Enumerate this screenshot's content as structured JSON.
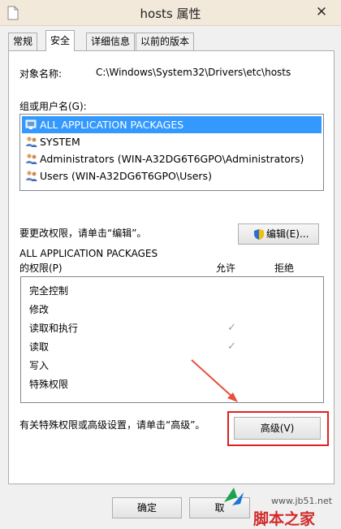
{
  "window": {
    "title": "hosts 属性",
    "close_glyph": "✕"
  },
  "tabs": [
    {
      "label": "常规"
    },
    {
      "label": "安全"
    },
    {
      "label": "详细信息"
    },
    {
      "label": "以前的版本"
    }
  ],
  "security": {
    "object_name_label": "对象名称:",
    "object_name_value": "C:\\Windows\\System32\\Drivers\\etc\\hosts",
    "users_label": "组或用户名(G):",
    "users": [
      {
        "name": "ALL APPLICATION PACKAGES",
        "selected": true
      },
      {
        "name": "SYSTEM"
      },
      {
        "name": "Administrators (WIN-A32DG6T6GPO\\Administrators)"
      },
      {
        "name": "Users (WIN-A32DG6T6GPO\\Users)"
      }
    ],
    "change_hint": "要更改权限，请单击“编辑”。",
    "edit_button": "编辑(E)...",
    "perm_for_line1": "ALL APPLICATION PACKAGES",
    "perm_for_line2": "的权限(P)",
    "allow_header": "允许",
    "deny_header": "拒绝",
    "permissions": [
      {
        "name": "完全控制",
        "allow": false
      },
      {
        "name": "修改",
        "allow": false
      },
      {
        "name": "读取和执行",
        "allow": true
      },
      {
        "name": "读取",
        "allow": true
      },
      {
        "name": "写入",
        "allow": false
      },
      {
        "name": "特殊权限",
        "allow": false
      }
    ],
    "advanced_hint": "有关特殊权限或高级设置，请单击“高级”。",
    "advanced_button": "高级(V)"
  },
  "footer": {
    "ok_button": "确定",
    "cancel_button_partial": "取"
  },
  "watermark": {
    "url": "www.jb51.net",
    "brand": "脚本之家"
  },
  "colors": {
    "selection": "#3399ff",
    "highlight_frame": "#e02020",
    "arrow": "#e8503c"
  }
}
